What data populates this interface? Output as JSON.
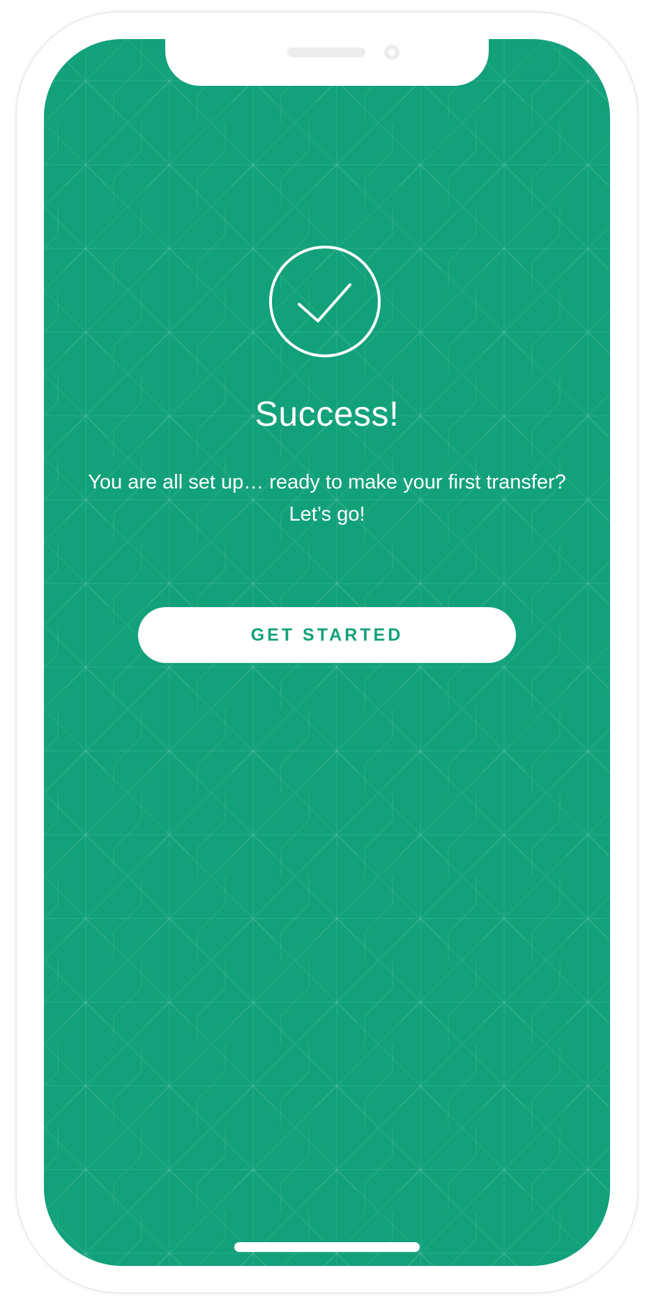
{
  "colors": {
    "accent": "#12a17a",
    "text_on_accent": "#ffffff",
    "frame": "#ffffff"
  },
  "icon": "checkmark-circle-icon",
  "screen": {
    "title": "Success!",
    "message": "You are all set up… ready to make your first transfer? Let’s go!",
    "cta_label": "GET STARTED"
  }
}
